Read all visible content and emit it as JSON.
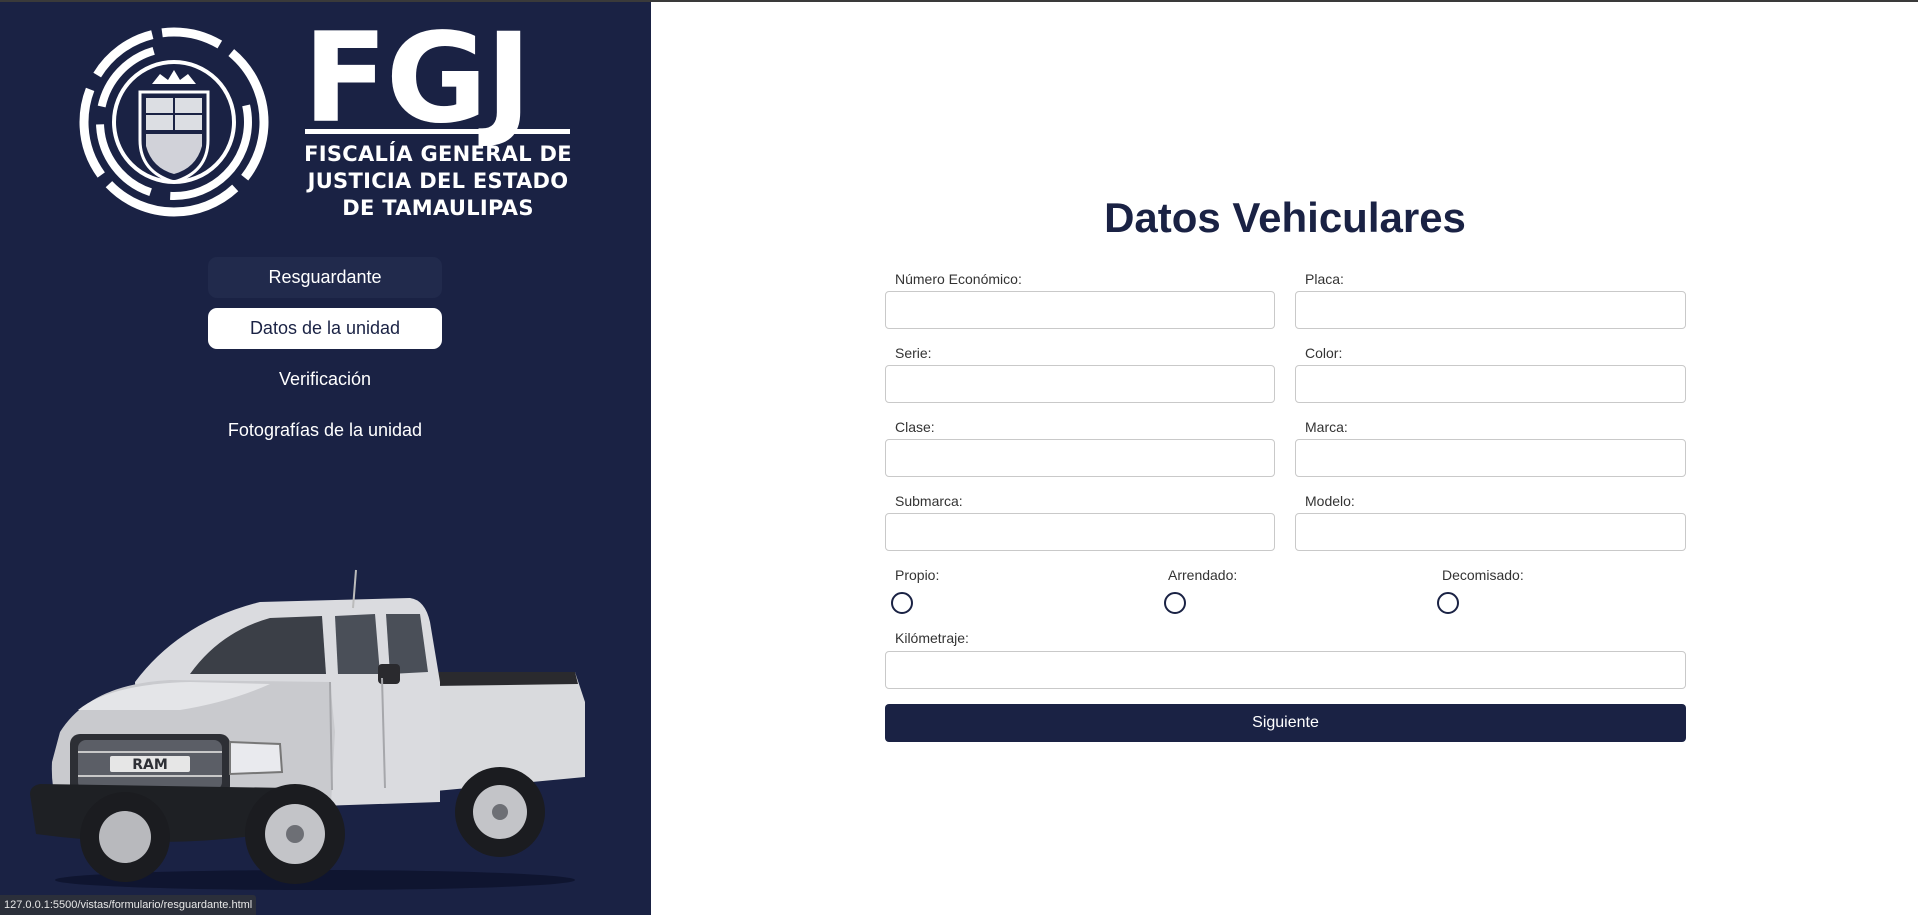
{
  "sidebar": {
    "logo": {
      "letters": "FGJ",
      "name_lines": [
        "FISCALÍA GENERAL DE",
        "JUSTICIA DEL ESTADO",
        "DE TAMAULIPAS"
      ]
    },
    "nav": [
      {
        "label": "Resguardante",
        "state": "hover"
      },
      {
        "label": "Datos de la unidad",
        "state": "active"
      },
      {
        "label": "Verificación",
        "state": "normal"
      },
      {
        "label": "Fotografías de la unidad",
        "state": "normal"
      }
    ],
    "truck_badge": "RAM"
  },
  "status_url": "127.0.0.1:5500/vistas/formulario/resguardante.html",
  "form": {
    "title": "Datos Vehiculares",
    "fields": {
      "numero_economico": {
        "label": "Número Económico:",
        "value": ""
      },
      "placa": {
        "label": "Placa:",
        "value": ""
      },
      "serie": {
        "label": "Serie:",
        "value": ""
      },
      "color": {
        "label": "Color:",
        "value": ""
      },
      "clase": {
        "label": "Clase:",
        "value": ""
      },
      "marca": {
        "label": "Marca:",
        "value": ""
      },
      "submarca": {
        "label": "Submarca:",
        "value": ""
      },
      "modelo": {
        "label": "Modelo:",
        "value": ""
      },
      "kilometraje": {
        "label": "Kilómetraje:",
        "value": ""
      }
    },
    "ownership": [
      {
        "label": "Propio:",
        "checked": false
      },
      {
        "label": "Arrendado:",
        "checked": false
      },
      {
        "label": "Decomisado:",
        "checked": false
      }
    ],
    "submit_label": "Siguiente"
  },
  "colors": {
    "sidebar_bg": "#1a2244",
    "accent": "#1a2244",
    "nav_hover_bg": "#212a4c"
  }
}
